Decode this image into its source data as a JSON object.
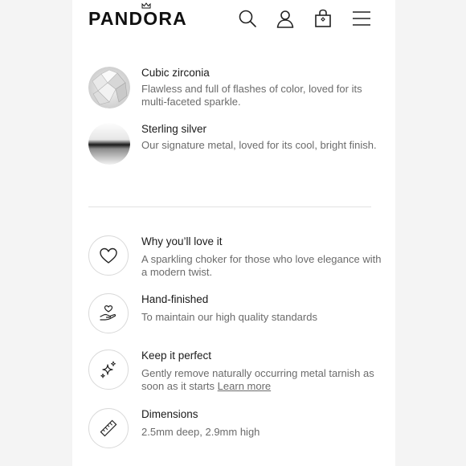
{
  "header": {
    "logo": "PANDORA",
    "icons": [
      "search-icon",
      "account-icon",
      "shopping-bag-icon",
      "menu-icon"
    ]
  },
  "materials": [
    {
      "title": "Cubic zirconia",
      "description": "Flawless and full of flashes of color, loved for its multi-faceted sparkle.",
      "swatch": "cubic-zirconia-swatch"
    },
    {
      "title": "Sterling silver",
      "description": "Our signature metal, loved for its cool, bright finish.",
      "swatch": "sterling-silver-swatch"
    }
  ],
  "features": [
    {
      "icon": "heart-icon",
      "title": "Why you’ll love it",
      "description": "A sparkling choker for those who love elegance with a modern twist."
    },
    {
      "icon": "hand-heart-icon",
      "title": "Hand-finished",
      "description": "To maintain our high quality standards"
    },
    {
      "icon": "sparkle-icon",
      "title": "Keep it perfect",
      "description": "Gently remove naturally occurring metal tarnish as soon as it starts",
      "link": "Learn more"
    },
    {
      "icon": "ruler-icon",
      "title": "Dimensions",
      "description": "2.5mm deep, 2.9mm high"
    }
  ],
  "colors": {
    "background": "#f4f4f4",
    "panel": "#ffffff",
    "text": "#1a1a1a",
    "muted": "#6b6b6b",
    "divider": "#e2e2e2"
  }
}
